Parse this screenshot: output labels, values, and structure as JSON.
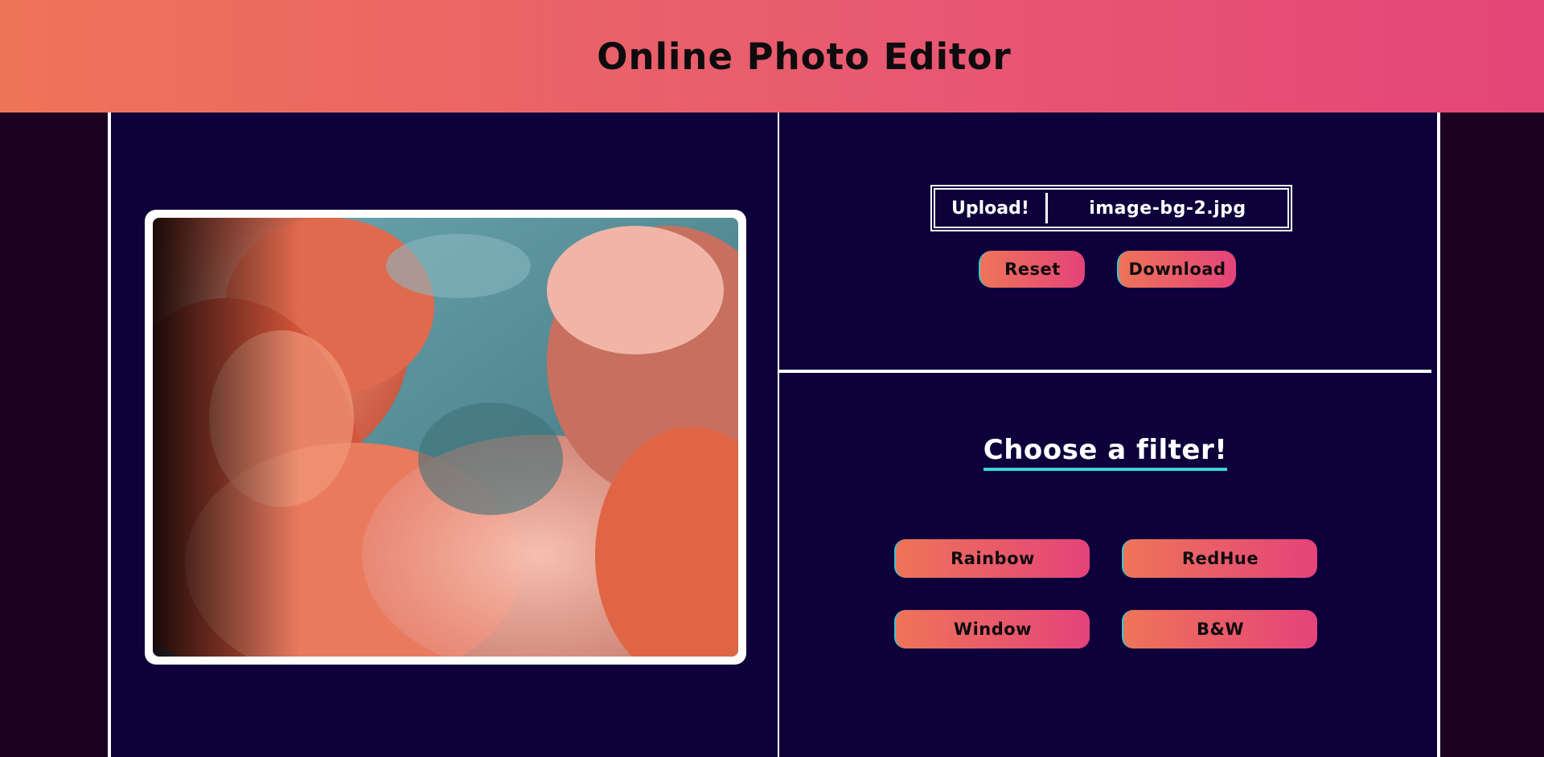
{
  "header": {
    "title": "Online Photo Editor"
  },
  "uploader": {
    "button_label": "Upload!",
    "file_name": "image-bg-2.jpg"
  },
  "actions": {
    "reset_label": "Reset",
    "download_label": "Download"
  },
  "filters": {
    "title": "Choose a filter!",
    "items": [
      {
        "label": "Rainbow"
      },
      {
        "label": "RedHue"
      },
      {
        "label": "Window"
      },
      {
        "label": "B&W"
      }
    ]
  },
  "colors": {
    "header_gradient_start": "#ee7458",
    "header_gradient_end": "#e44677",
    "panel_background": "#0d003b",
    "page_background": "#1c0121",
    "title_underline": "#3ad4d6"
  }
}
